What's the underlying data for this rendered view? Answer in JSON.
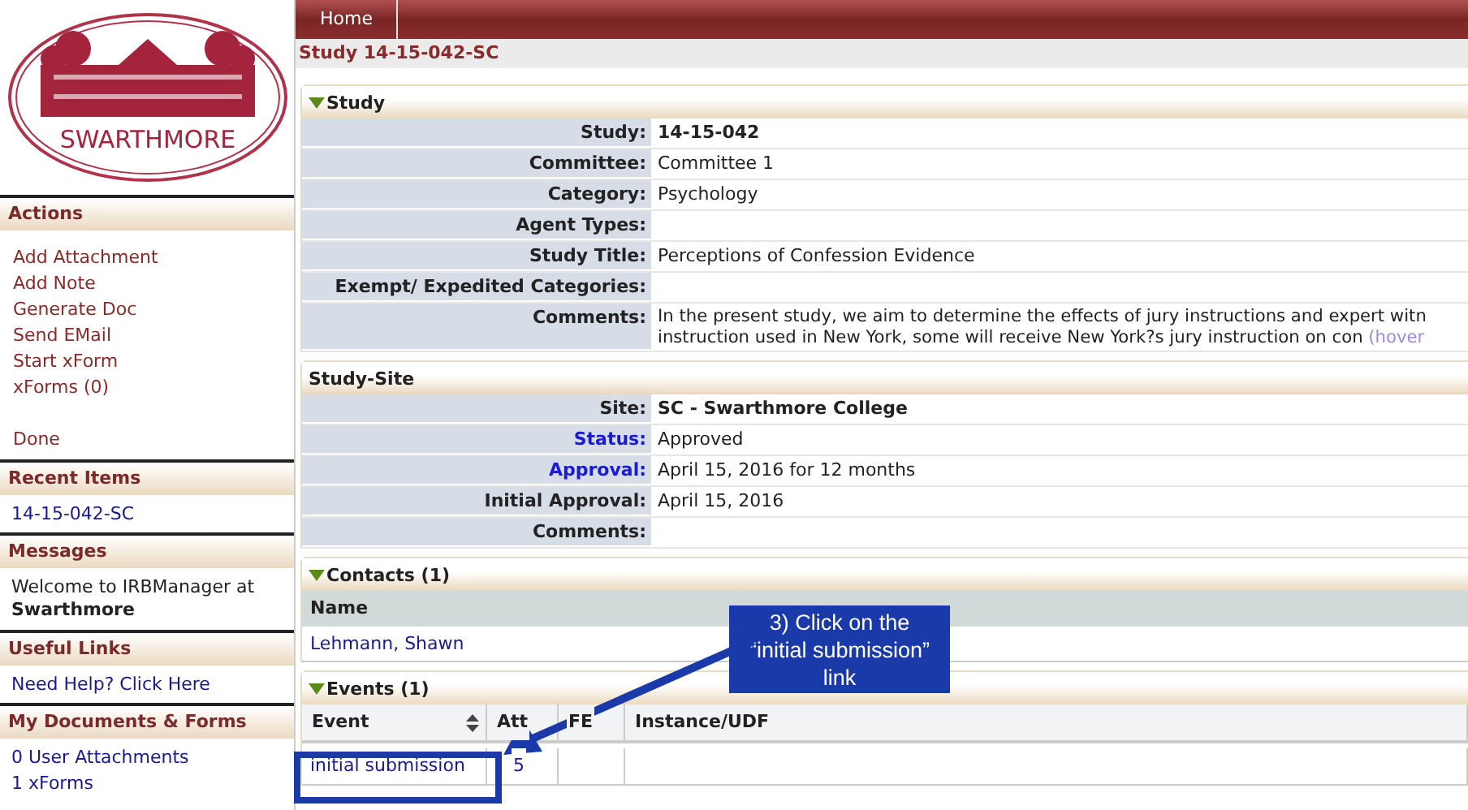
{
  "logo": {
    "text": "SWARTHMORE"
  },
  "sidebar": [
    {
      "title": "Actions",
      "items": [
        {
          "text": "Add Attachment",
          "kind": "action"
        },
        {
          "text": "Add Note",
          "kind": "action"
        },
        {
          "text": "Generate Doc",
          "kind": "action"
        },
        {
          "text": "Send EMail",
          "kind": "action"
        },
        {
          "text": "Start xForm",
          "kind": "action"
        },
        {
          "text": "xForms (0)",
          "kind": "action"
        },
        {
          "text": "Done",
          "kind": "done"
        }
      ]
    },
    {
      "title": "Recent Items",
      "items": [
        {
          "text": "14-15-042-SC",
          "kind": "link"
        }
      ]
    },
    {
      "title": "Messages",
      "items": [
        {
          "text": "Welcome to IRBManager at **Swarthmore**",
          "kind": "message"
        }
      ]
    },
    {
      "title": "Useful Links",
      "items": [
        {
          "text": "Need Help? Click Here",
          "kind": "link"
        }
      ]
    },
    {
      "title": "My Documents & Forms",
      "items": [
        {
          "text": "0 User Attachments",
          "kind": "link"
        },
        {
          "text": "1 xForms",
          "kind": "link"
        }
      ]
    }
  ],
  "nav": {
    "tabs": [
      {
        "label": "Home"
      }
    ]
  },
  "page_title": "Study 14-15-042-SC",
  "study": {
    "title": "Study",
    "expanded": true,
    "rows": [
      {
        "label": "Study:",
        "value": "14-15-042",
        "bold": true
      },
      {
        "label": "Committee:",
        "value": "Committee 1"
      },
      {
        "label": "Category:",
        "value": "Psychology"
      },
      {
        "label": "Agent Types:"
      },
      {
        "label": "Study Title:",
        "value": "Perceptions of Confession Evidence"
      },
      {
        "label": "Exempt/ Expedited Categories:"
      },
      {
        "label": "Comments:",
        "value": "In the present study, we aim to determine the effects of jury instructions and expert witn",
        "value_2": "instruction used in New York, some will receive New York?s jury instruction on con",
        "link": "(hover"
      }
    ]
  },
  "study_site": {
    "title": "Study-Site",
    "rows": [
      {
        "label": "Site:",
        "value": "SC - Swarthmore College",
        "bold": true
      },
      {
        "label": "Status:",
        "value": "Approved",
        "label_link": true
      },
      {
        "label": "Approval:",
        "value": "April 15, 2016 for 12 months",
        "label_link": true
      },
      {
        "label": "Initial Approval:",
        "value": "April 15, 2016"
      },
      {
        "label": "Comments:"
      }
    ]
  },
  "contacts": {
    "title": "Contacts (1)",
    "expanded": true,
    "columns": [
      "Name"
    ],
    "rows": [
      "Lehmann, Shawn"
    ]
  },
  "events": {
    "title": "Events (1)",
    "expanded": true,
    "columns": [
      "Event",
      "Att",
      "FE",
      "Instance/UDF"
    ],
    "rows": [
      [
        "initial submission",
        "5",
        "",
        ""
      ]
    ]
  },
  "callout": {
    "text": "3) Click on the “initial submission” link"
  }
}
